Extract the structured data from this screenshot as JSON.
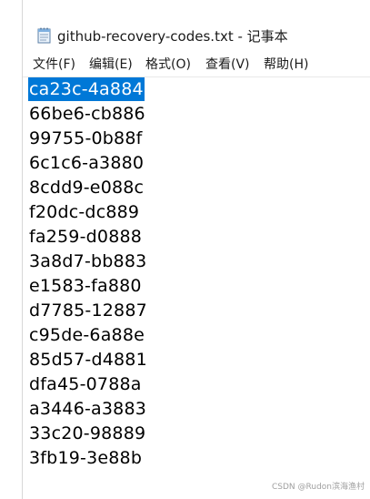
{
  "window": {
    "title": "github-recovery-codes.txt - 记事本",
    "icon": "notepad-icon"
  },
  "menu": [
    {
      "label": "文件(F)"
    },
    {
      "label": "编辑(E)"
    },
    {
      "label": "格式(O)"
    },
    {
      "label": "查看(V)"
    },
    {
      "label": "帮助(H)"
    }
  ],
  "lines": [
    "ca23c-4a884",
    "66be6-cb886",
    "99755-0b88f",
    "6c1c6-a3880",
    "8cdd9-e088c",
    "f20dc-dc889",
    "fa259-d0888",
    "3a8d7-bb883",
    "e1583-fa880",
    "d7785-12887",
    "c95de-6a88e",
    "85d57-d4881",
    "dfa45-0788a",
    "a3446-a3883",
    "33c20-98889",
    "3fb19-3e88b"
  ],
  "selection_color": "#0078d7",
  "watermark": "CSDN @Rudon滨海渔村"
}
